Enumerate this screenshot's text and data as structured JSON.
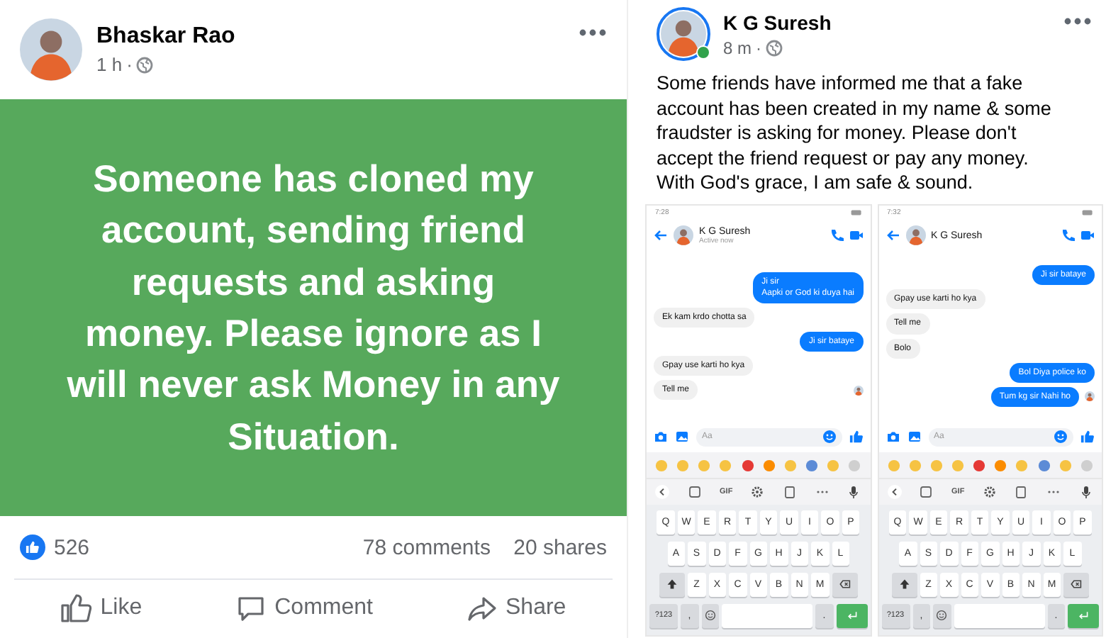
{
  "image_post": {
    "author": "Bhaskar Rao",
    "time": "1 h",
    "time_separator": "·",
    "banner_text": "Someone has cloned my account, sending friend requests and asking money. Please ignore as I will never ask Money in any Situation.",
    "reaction_count": "526",
    "comments": "78 comments",
    "shares": "20 shares",
    "actions": [
      "Like",
      "Comment",
      "Share"
    ]
  },
  "text_post": {
    "author": "K G Suresh",
    "time": "8 m",
    "time_separator": "·",
    "online": true,
    "body": "Some friends have informed me that a fake account has been created in my name & some fraudster is asking for money. Please don't accept the friend request or pay any money. With God's grace, I am safe & sound.",
    "screenshots": [
      {
        "status_time": "7:28",
        "contact": "K G Suresh",
        "contact_status": "Active now",
        "messages": [
          {
            "text": "Ji sir\nAapki or God ki duya hai",
            "from_me": true,
            "seen": false
          },
          {
            "text": "Ek kam krdo chotta sa",
            "from_me": false,
            "seen": false
          },
          {
            "text": "Ji sir bataye",
            "from_me": true,
            "seen": false
          },
          {
            "text": "Gpay use karti ho kya",
            "from_me": false,
            "seen": false
          },
          {
            "text": "Tell me",
            "from_me": false,
            "seen": true
          }
        ],
        "composer_placeholder": "Aa",
        "gif_label": "GIF",
        "letter_rows": [
          [
            "Q",
            "W",
            "E",
            "R",
            "T",
            "Y",
            "U",
            "I",
            "O",
            "P"
          ],
          [
            "A",
            "S",
            "D",
            "F",
            "G",
            "H",
            "J",
            "K",
            "L"
          ],
          [
            "Z",
            "X",
            "C",
            "V",
            "B",
            "N",
            "M"
          ]
        ],
        "symbols_key": "?123",
        "comma_key": ",",
        "period_key": "."
      },
      {
        "status_time": "7:32",
        "contact": "K G Suresh",
        "messages": [
          {
            "text": "Ji sir bataye",
            "from_me": true,
            "seen": false
          },
          {
            "text": "Gpay use karti ho kya",
            "from_me": false,
            "seen": false
          },
          {
            "text": "Tell me",
            "from_me": false,
            "seen": false
          },
          {
            "text": "Bolo",
            "from_me": false,
            "seen": false
          },
          {
            "text": "Bol Diya police ko",
            "from_me": true,
            "seen": false
          },
          {
            "text": "Tum kg sir Nahi ho",
            "from_me": true,
            "seen": true
          }
        ],
        "composer_placeholder": "Aa",
        "gif_label": "GIF",
        "letter_rows": [
          [
            "Q",
            "W",
            "E",
            "R",
            "T",
            "Y",
            "U",
            "I",
            "O",
            "P"
          ],
          [
            "A",
            "S",
            "D",
            "F",
            "G",
            "H",
            "J",
            "K",
            "L"
          ],
          [
            "Z",
            "X",
            "C",
            "V",
            "B",
            "N",
            "M"
          ]
        ],
        "symbols_key": "?123",
        "comma_key": ",",
        "period_key": "."
      }
    ]
  }
}
